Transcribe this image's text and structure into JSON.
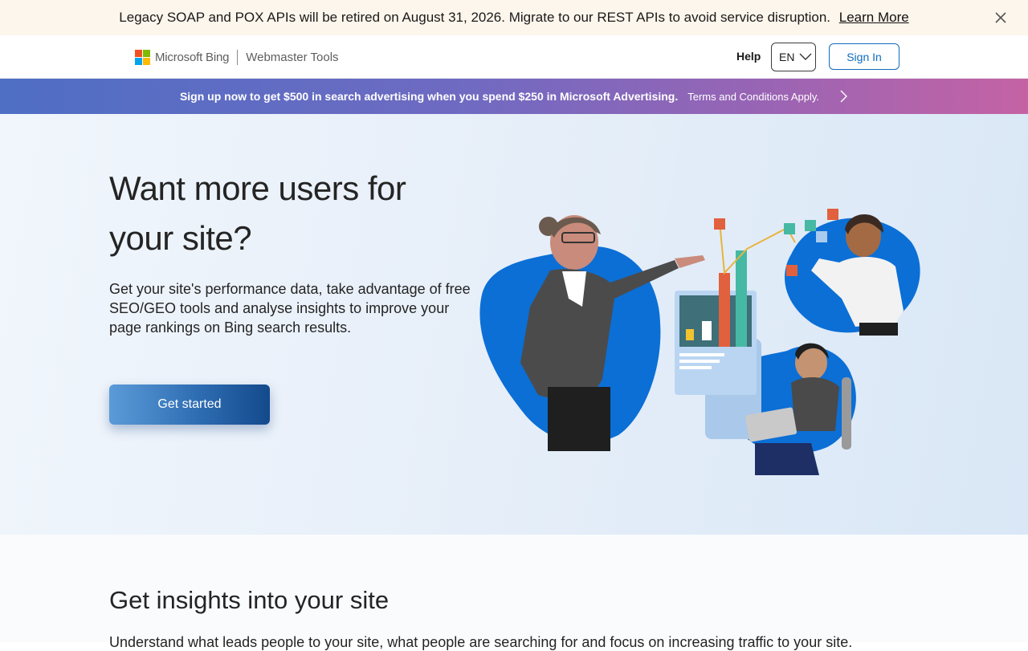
{
  "notice": {
    "message": "Legacy SOAP and POX APIs will be retired on August 31, 2026. Migrate to our REST APIs to avoid service disruption.",
    "link_label": "Learn More",
    "close_icon": "close-icon"
  },
  "header": {
    "brand": "Microsoft Bing",
    "product": "Webmaster Tools",
    "help": "Help",
    "language": "EN",
    "sign_in": "Sign In",
    "logo_colors": [
      "#f25022",
      "#7fba00",
      "#00a4ef",
      "#ffb900"
    ]
  },
  "promo": {
    "text": "Sign up now to get $500 in search advertising when you spend $250 in Microsoft Advertising.",
    "terms": "Terms and Conditions Apply.",
    "arrow_icon": "chevron-right-icon"
  },
  "hero": {
    "title": "Want more users for your site?",
    "subtitle": "Get your site's performance data, take advantage of free SEO/GEO tools and analyse insights to improve your page rankings on Bing search results.",
    "cta": "Get started"
  },
  "insights": {
    "title": "Get insights into your site",
    "text": "Understand what leads people to your site, what people are searching for and focus on increasing traffic to your site."
  },
  "colors": {
    "accent": "#0f6cbd",
    "illustration_blue": "#0b6fd6"
  }
}
